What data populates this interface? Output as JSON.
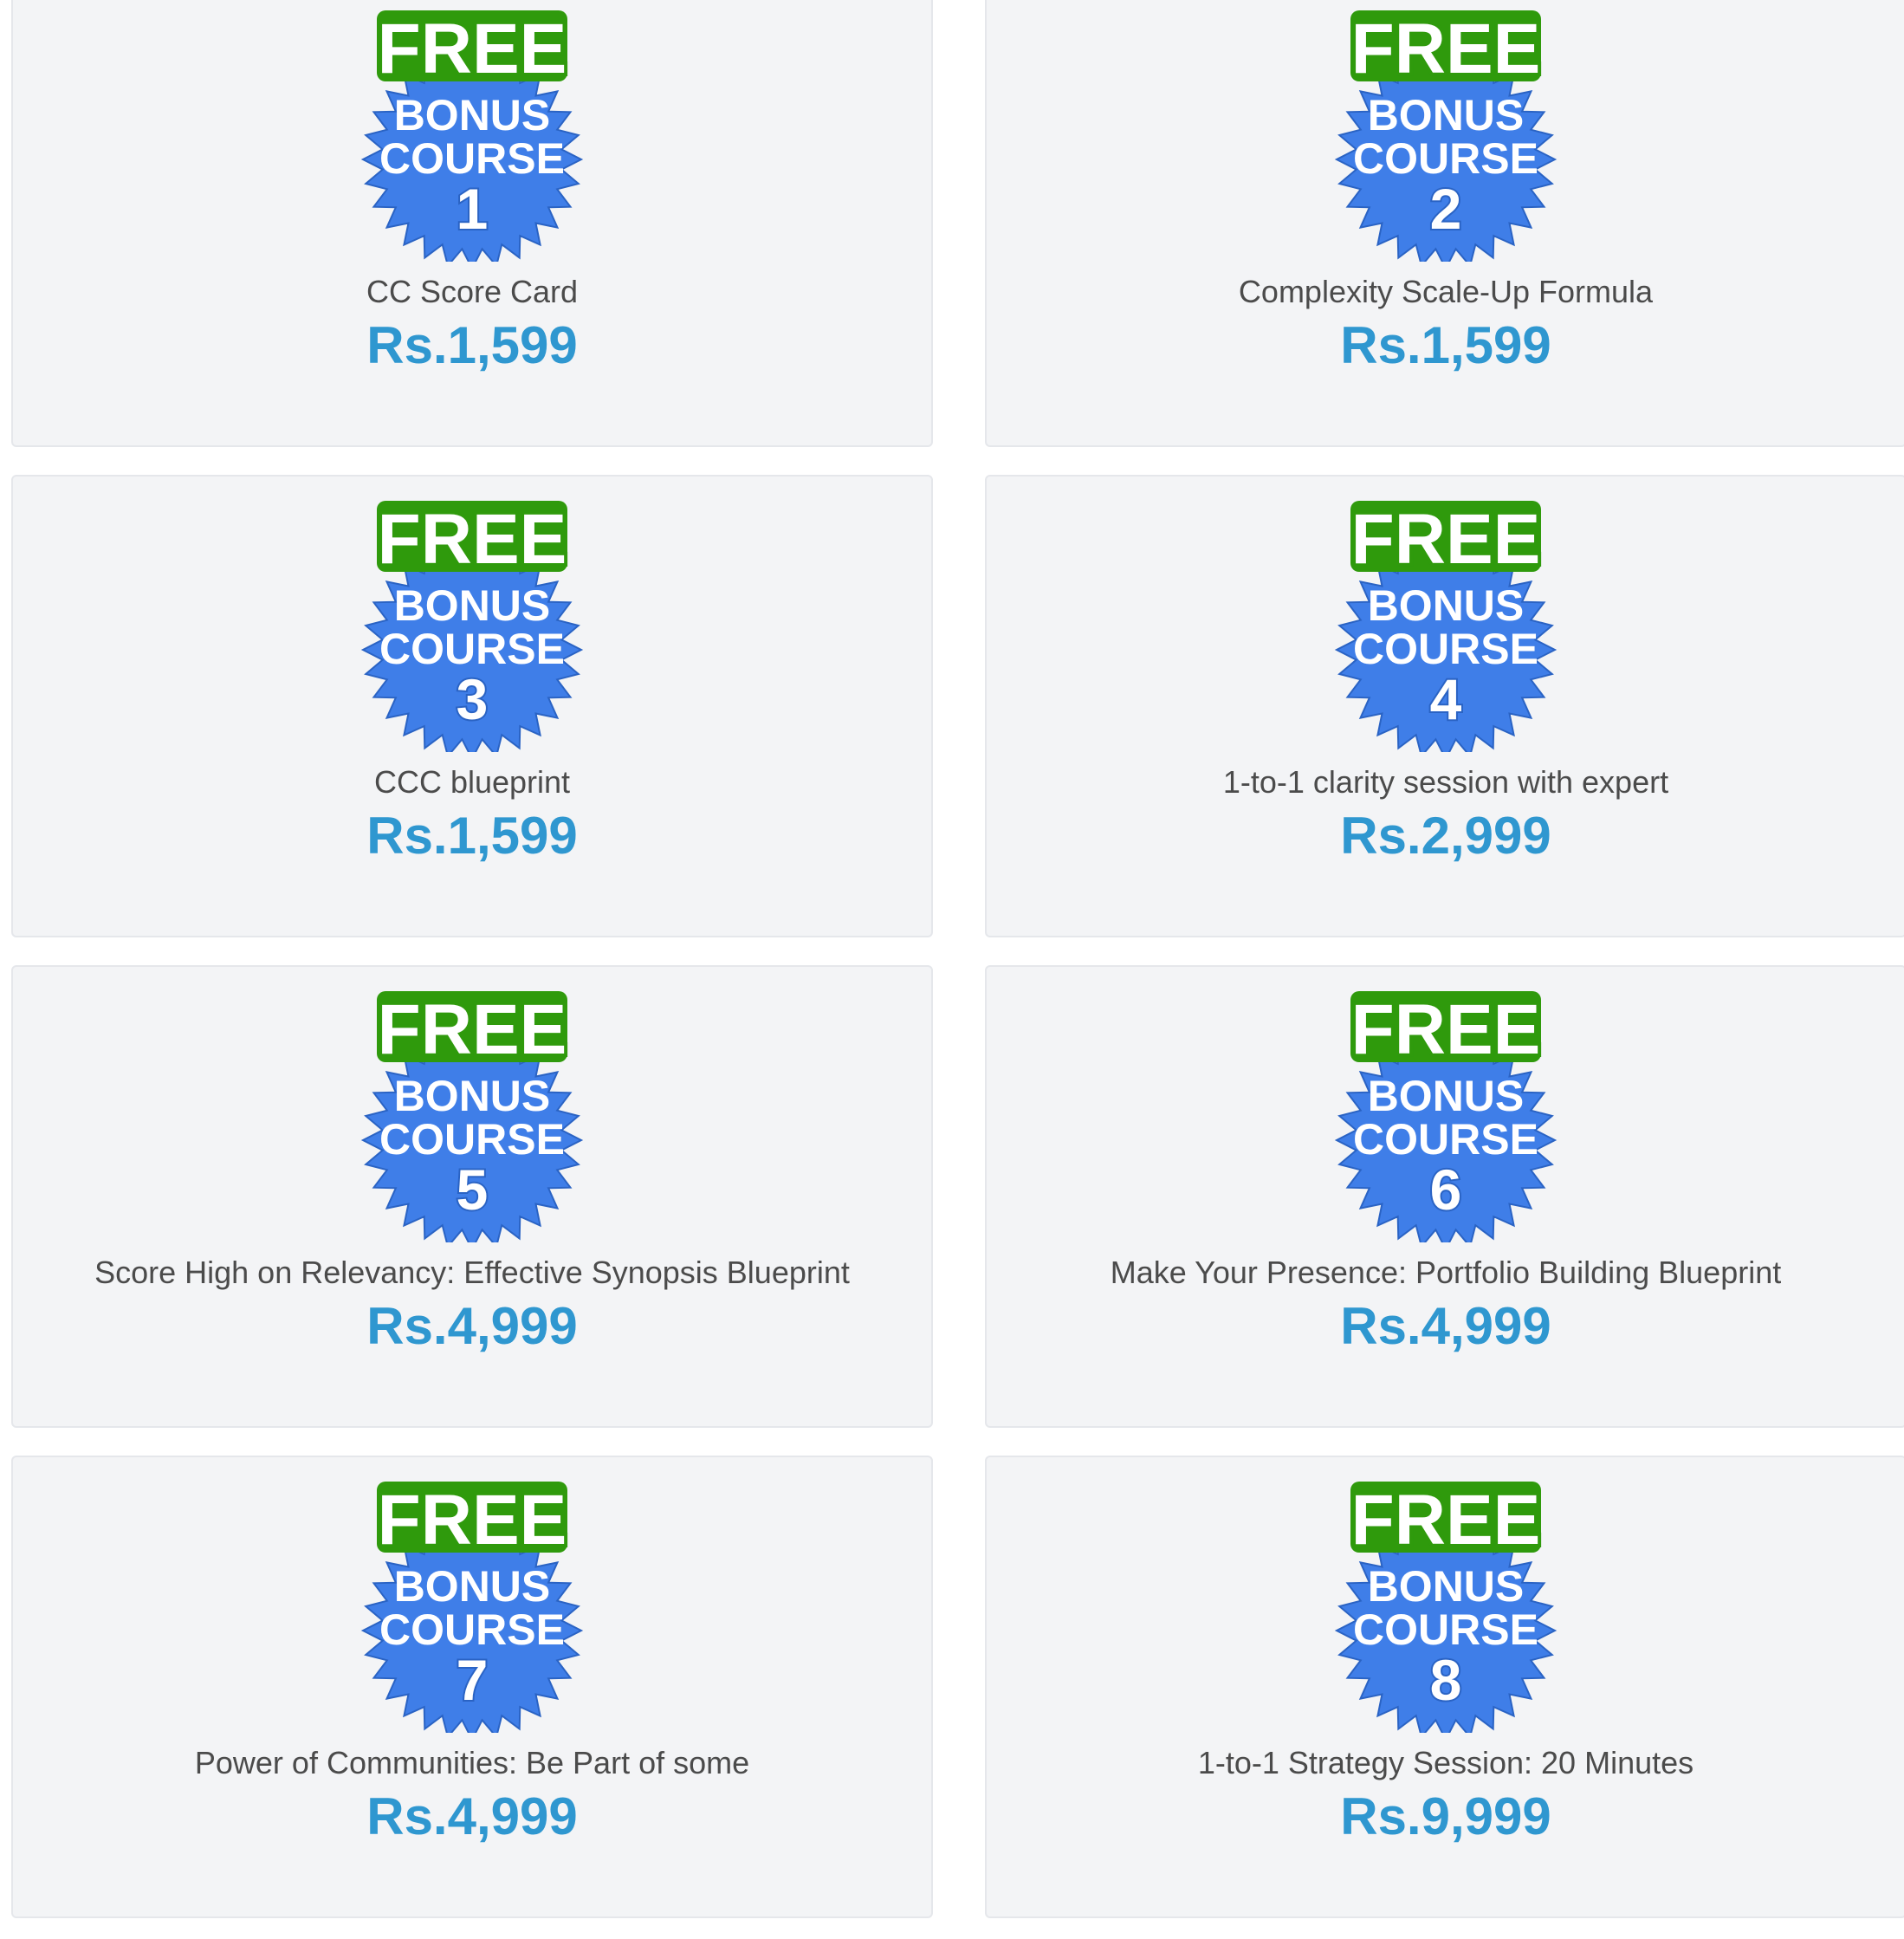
{
  "badge": {
    "free_text": "FREE",
    "bonus_text": "BONUS",
    "course_text": "COURSE",
    "colors": {
      "green": "#4fc320",
      "green_dark": "#2f9a0c",
      "blue": "#3f7ee8",
      "blue_dark": "#2a63c4"
    }
  },
  "cards": [
    {
      "number": "1",
      "title": "CC Score Card",
      "price": "Rs.1,599"
    },
    {
      "number": "2",
      "title": "Complexity Scale-Up Formula",
      "price": "Rs.1,599"
    },
    {
      "number": "3",
      "title": "CCC blueprint",
      "price": "Rs.1,599"
    },
    {
      "number": "4",
      "title": "1-to-1 clarity session with expert",
      "price": "Rs.2,999"
    },
    {
      "number": "5",
      "title": "Score High on Relevancy: Effective Synopsis Blueprint",
      "price": "Rs.4,999"
    },
    {
      "number": "6",
      "title": "Make Your Presence: Portfolio Building Blueprint",
      "price": "Rs.4,999"
    },
    {
      "number": "7",
      "title": "Power of Communities: Be Part of some",
      "price": "Rs.4,999"
    },
    {
      "number": "8",
      "title": "1-to-1 Strategy Session: 20 Minutes",
      "price": "Rs.9,999"
    }
  ]
}
